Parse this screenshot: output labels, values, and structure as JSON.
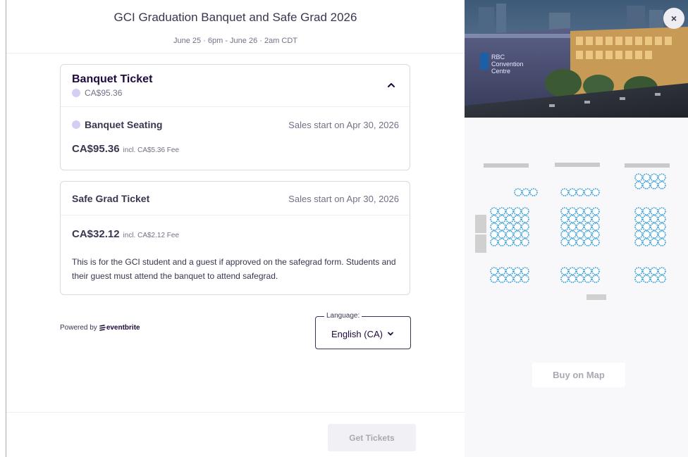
{
  "event": {
    "title": "GCI Graduation Banquet and Safe Grad 2026",
    "date": "June 25 · 6pm - June 26 · 2am CDT"
  },
  "tickets": [
    {
      "name": "Banquet Ticket",
      "price": "CA$95.36",
      "expanded": true,
      "sub_item": {
        "name": "Banquet Seating",
        "sales": "Sales start on Apr 30, 2026",
        "price": "CA$95.36",
        "fee": "incl. CA$5.36 Fee"
      }
    },
    {
      "name": "Safe Grad Ticket",
      "sales": "Sales start on Apr 30, 2026",
      "price": "CA$32.12",
      "fee": "incl. CA$2.12 Fee",
      "description": "This is for the GCI student and a guest if approved on the safegrad form. Students and their guest must attend the banquet to attend safegrad."
    }
  ],
  "footer_left": {
    "powered_by": "Powered by",
    "brand": "eventbrite"
  },
  "language": {
    "label": "Language:",
    "value": "English (CA)"
  },
  "actions": {
    "get_tickets": "Get Tickets",
    "buy_on_map": "Buy on Map",
    "close": "×"
  },
  "venue_photo": {
    "sign": "RBC Convention Centre"
  },
  "colors": {
    "seat": "#2f9bd6",
    "ticket_dot": "#d6cdf5",
    "disabled_text": "#a9a8b3",
    "primary_text": "#39364f"
  }
}
